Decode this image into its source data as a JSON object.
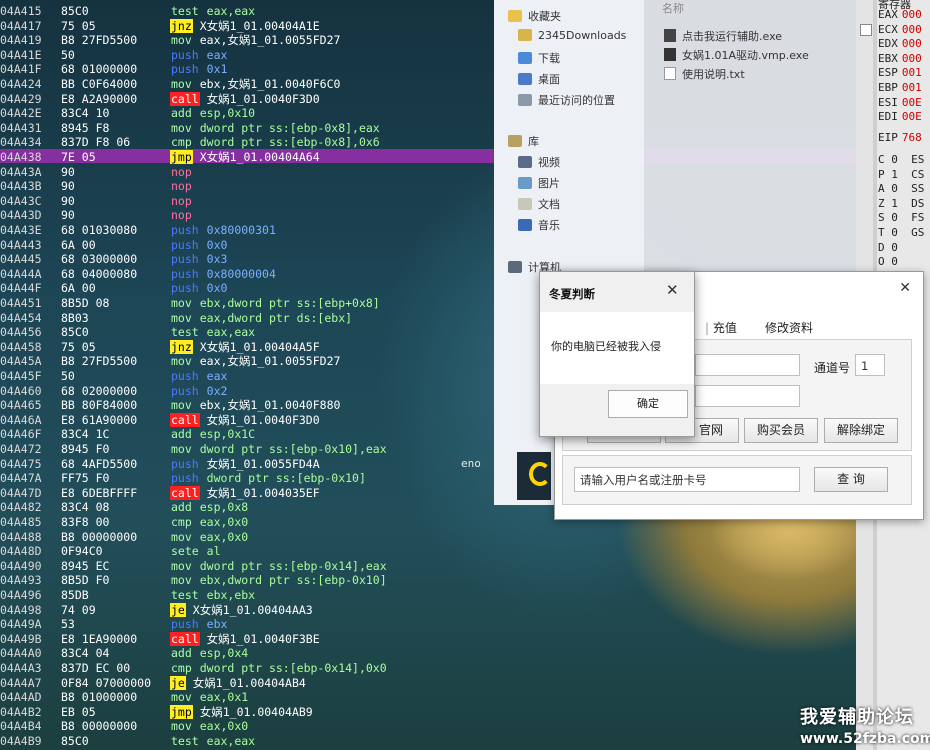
{
  "disasm": [
    {
      "addr": "04A415",
      "hex": "85C0",
      "mn": "test",
      "args": "eax,eax",
      "argc": "green"
    },
    {
      "addr": "04A417",
      "hex": "75 05",
      "mn": "jnz",
      "args": "X女娲1_01.00404A1E",
      "argc": "white"
    },
    {
      "addr": "04A419",
      "hex": "B8 27FD5500",
      "mn": "mov",
      "args": "eax,女娲1_01.0055FD27",
      "argc": "white"
    },
    {
      "addr": "04A41E",
      "hex": "50",
      "mn": "push",
      "args": "eax",
      "argc": "blue"
    },
    {
      "addr": "04A41F",
      "hex": "68 01000000",
      "mn": "push",
      "args": "0x1",
      "argc": "blue"
    },
    {
      "addr": "04A424",
      "hex": "BB C0F64000",
      "mn": "mov",
      "args": "ebx,女娲1_01.0040F6C0",
      "argc": "white"
    },
    {
      "addr": "04A429",
      "hex": "E8 A2A90000",
      "mn": "call",
      "args": "女娲1_01.0040F3D0",
      "argc": "white"
    },
    {
      "addr": "04A42E",
      "hex": "83C4 10",
      "mn": "add",
      "args": "esp,0x10",
      "argc": "green"
    },
    {
      "addr": "04A431",
      "hex": "8945 F8",
      "mn": "mov",
      "args": "dword ptr ss:[ebp-0x8],eax",
      "argc": "green"
    },
    {
      "addr": "04A434",
      "hex": "837D F8 06",
      "mn": "cmp",
      "args": "dword ptr ss:[ebp-0x8],0x6",
      "argc": "green"
    },
    {
      "addr": "04A438",
      "hex": "7E 05",
      "mn": "jmp",
      "args": "X女娲1_01.00404A64",
      "argc": "purple"
    },
    {
      "addr": "04A43A",
      "hex": "90",
      "mn": "nop",
      "args": "",
      "argc": "white"
    },
    {
      "addr": "04A43B",
      "hex": "90",
      "mn": "nop",
      "args": "",
      "argc": "white"
    },
    {
      "addr": "04A43C",
      "hex": "90",
      "mn": "nop",
      "args": "",
      "argc": "white"
    },
    {
      "addr": "04A43D",
      "hex": "90",
      "mn": "nop",
      "args": "",
      "argc": "white"
    },
    {
      "addr": "04A43E",
      "hex": "68 01030080",
      "mn": "push",
      "args": "0x80000301",
      "argc": "blue"
    },
    {
      "addr": "04A443",
      "hex": "6A 00",
      "mn": "push",
      "args": "0x0",
      "argc": "blue"
    },
    {
      "addr": "04A445",
      "hex": "68 03000000",
      "mn": "push",
      "args": "0x3",
      "argc": "blue"
    },
    {
      "addr": "04A44A",
      "hex": "68 04000080",
      "mn": "push",
      "args": "0x80000004",
      "argc": "blue"
    },
    {
      "addr": "04A44F",
      "hex": "6A 00",
      "mn": "push",
      "args": "0x0",
      "argc": "blue"
    },
    {
      "addr": "04A451",
      "hex": "8B5D 08",
      "mn": "mov",
      "args": "ebx,dword ptr ss:[ebp+0x8]",
      "argc": "green"
    },
    {
      "addr": "04A454",
      "hex": "8B03",
      "mn": "mov",
      "args": "eax,dword ptr ds:[ebx]",
      "argc": "green"
    },
    {
      "addr": "04A456",
      "hex": "85C0",
      "mn": "test",
      "args": "eax,eax",
      "argc": "green"
    },
    {
      "addr": "04A458",
      "hex": "75 05",
      "mn": "jnz",
      "args": "X女娲1_01.00404A5F",
      "argc": "white"
    },
    {
      "addr": "04A45A",
      "hex": "B8 27FD5500",
      "mn": "mov",
      "args": "eax,女娲1_01.0055FD27",
      "argc": "white"
    },
    {
      "addr": "04A45F",
      "hex": "50",
      "mn": "push",
      "args": "eax",
      "argc": "blue"
    },
    {
      "addr": "04A460",
      "hex": "68 02000000",
      "mn": "push",
      "args": "0x2",
      "argc": "blue"
    },
    {
      "addr": "04A465",
      "hex": "BB 80F84000",
      "mn": "mov",
      "args": "ebx,女娲1_01.0040F880",
      "argc": "white"
    },
    {
      "addr": "04A46A",
      "hex": "E8 61A90000",
      "mn": "call",
      "args": "女娲1_01.0040F3D0",
      "argc": "white"
    },
    {
      "addr": "04A46F",
      "hex": "83C4 1C",
      "mn": "add",
      "args": "esp,0x1C",
      "argc": "green"
    },
    {
      "addr": "04A472",
      "hex": "8945 F0",
      "mn": "mov",
      "args": "dword ptr ss:[ebp-0x10],eax",
      "argc": "green"
    },
    {
      "addr": "04A475",
      "hex": "68 4AFD5500",
      "mn": "push",
      "args": "女娲1_01.0055FD4A",
      "argc": "white"
    },
    {
      "addr": "04A47A",
      "hex": "FF75 F0",
      "mn": "push",
      "args": "dword ptr ss:[ebp-0x10]",
      "argc": "green"
    },
    {
      "addr": "04A47D",
      "hex": "E8 6DEBFFFF",
      "mn": "call",
      "args": "女娲1_01.004035EF",
      "argc": "white"
    },
    {
      "addr": "04A482",
      "hex": "83C4 08",
      "mn": "add",
      "args": "esp,0x8",
      "argc": "green"
    },
    {
      "addr": "04A485",
      "hex": "83F8 00",
      "mn": "cmp",
      "args": "eax,0x0",
      "argc": "green"
    },
    {
      "addr": "04A488",
      "hex": "B8 00000000",
      "mn": "mov",
      "args": "eax,0x0",
      "argc": "green"
    },
    {
      "addr": "04A48D",
      "hex": "0F94C0",
      "mn": "sete",
      "args": "al",
      "argc": "green"
    },
    {
      "addr": "04A490",
      "hex": "8945 EC",
      "mn": "mov",
      "args": "dword ptr ss:[ebp-0x14],eax",
      "argc": "green"
    },
    {
      "addr": "04A493",
      "hex": "8B5D F0",
      "mn": "mov",
      "args": "ebx,dword ptr ss:[ebp-0x10]",
      "argc": "green"
    },
    {
      "addr": "04A496",
      "hex": "85DB",
      "mn": "test",
      "args": "ebx,ebx",
      "argc": "green"
    },
    {
      "addr": "04A498",
      "hex": "74 09",
      "mn": "je",
      "args": "X女娲1_01.00404AA3",
      "argc": "white"
    },
    {
      "addr": "04A49A",
      "hex": "53",
      "mn": "push",
      "args": "ebx",
      "argc": "blue"
    },
    {
      "addr": "04A49B",
      "hex": "E8 1EA90000",
      "mn": "call",
      "args": "女娲1_01.0040F3BE",
      "argc": "white"
    },
    {
      "addr": "04A4A0",
      "hex": "83C4 04",
      "mn": "add",
      "args": "esp,0x4",
      "argc": "green"
    },
    {
      "addr": "04A4A3",
      "hex": "837D EC 00",
      "mn": "cmp",
      "args": "dword ptr ss:[ebp-0x14],0x0",
      "argc": "green"
    },
    {
      "addr": "04A4A7",
      "hex": "0F84 07000000",
      "mn": "je",
      "args": "女娲1_01.00404AB4",
      "argc": "white"
    },
    {
      "addr": "04A4AD",
      "hex": "B8 01000000",
      "mn": "mov",
      "args": "eax,0x1",
      "argc": "green"
    },
    {
      "addr": "04A4B2",
      "hex": "EB 05",
      "mn": "jmp",
      "args": "女娲1_01.00404AB9",
      "argc": "white"
    },
    {
      "addr": "04A4B4",
      "hex": "B8 00000000",
      "mn": "mov",
      "args": "eax,0x0",
      "argc": "green"
    },
    {
      "addr": "04A4B9",
      "hex": "85C0",
      "mn": "test",
      "args": "eax,eax",
      "argc": "green"
    }
  ],
  "explorer": {
    "header_name": "名称",
    "favorites": "收藏夹",
    "nav": [
      "2345Downloads",
      "下载",
      "桌面",
      "最近访问的位置"
    ],
    "library": "库",
    "lib_items": [
      "视频",
      "图片",
      "文档",
      "音乐"
    ],
    "computer": "计算机",
    "files": [
      "点击我运行辅助.exe",
      "女娲1.01A驱动.vmp.exe",
      "使用说明.txt"
    ]
  },
  "registers": {
    "title": "寄存器",
    "regs": [
      {
        "n": "EAX",
        "v": "000"
      },
      {
        "n": "ECX",
        "v": "000"
      },
      {
        "n": "EDX",
        "v": "000"
      },
      {
        "n": "EBX",
        "v": "000"
      },
      {
        "n": "ESP",
        "v": "001"
      },
      {
        "n": "EBP",
        "v": "001"
      },
      {
        "n": "ESI",
        "v": "00E"
      },
      {
        "n": "EDI",
        "v": "00E"
      }
    ],
    "eip": {
      "n": "EIP",
      "v": "768"
    },
    "flags": [
      "C 0  ES",
      "P 1  CS",
      "A 0  SS",
      "Z 1  DS",
      "S 0  FS",
      "T 0  GS",
      "D 0",
      "O 0"
    ]
  },
  "main_window": {
    "tabs": [
      "充值",
      "修改资料"
    ],
    "channel_label": "通道号",
    "channel_value": "1",
    "buttons": [
      "官网",
      "购买会员",
      "解除绑定"
    ],
    "query_placeholder": "请输入用户名或注册卡号",
    "query_button": "查 询"
  },
  "dialog": {
    "title": "冬夏判断",
    "message": "你的电脑已经被我入侵",
    "ok": "确定"
  },
  "misc": {
    "eno": "eno"
  },
  "watermark": {
    "line1": "我爱辅助论坛",
    "line2": "www.52fzba.com"
  }
}
